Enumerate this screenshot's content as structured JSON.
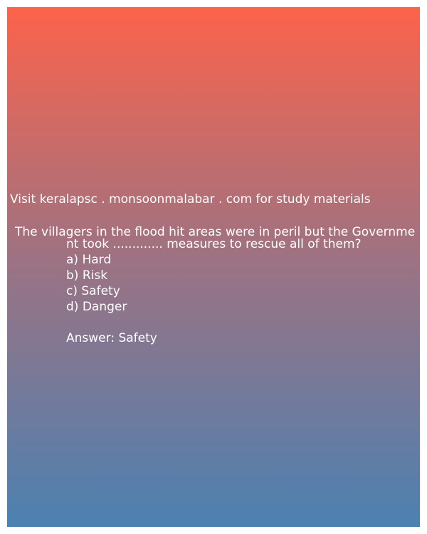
{
  "header": {
    "visit_text": "Visit keralapsc . monsoonmalabar . com for study materials"
  },
  "question": {
    "line1": "The villagers in the flood hit areas were in peril but the Governme",
    "line2": "nt took ............. measures to rescue all of them?"
  },
  "options": [
    {
      "text": "a) Hard"
    },
    {
      "text": "b) Risk"
    },
    {
      "text": "c) Safety"
    },
    {
      "text": "d) Danger"
    }
  ],
  "answer": {
    "text": "Answer: Safety"
  },
  "colors": {
    "gradient_top": "#fc634b",
    "gradient_bottom": "#4c81b1",
    "text": "#ffffff"
  }
}
